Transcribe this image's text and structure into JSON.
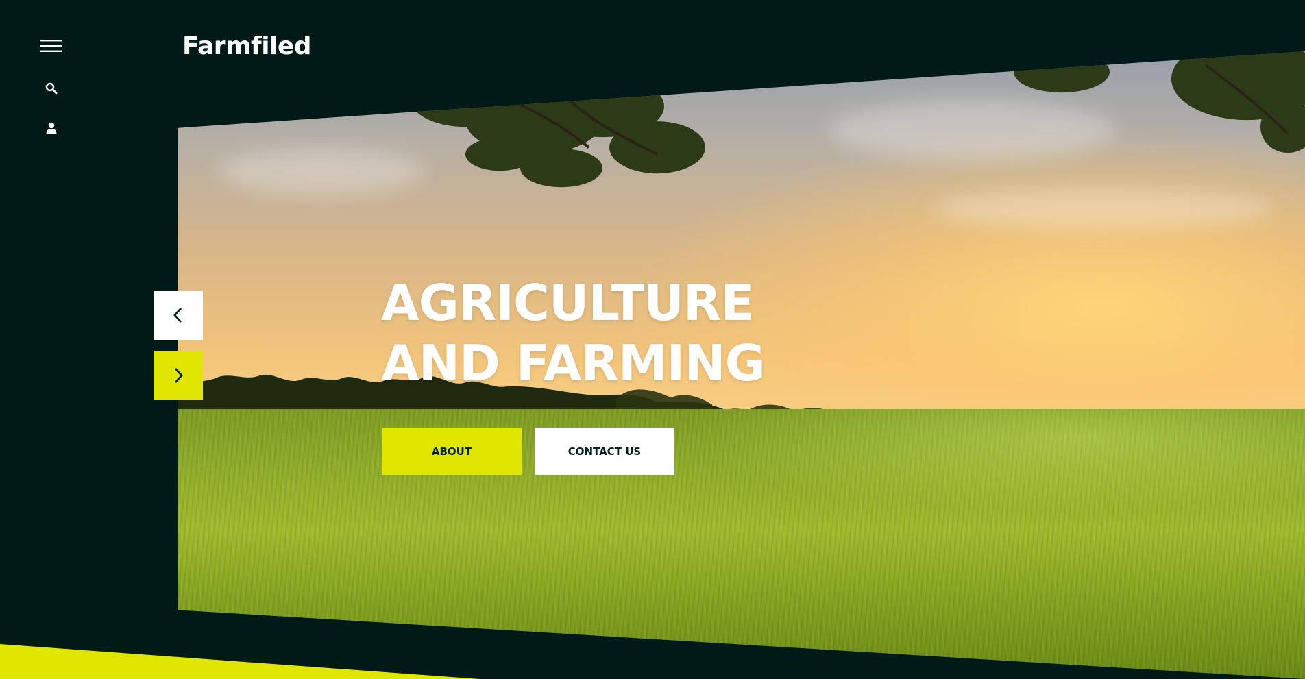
{
  "brand": {
    "logo_text": "Farmfiled"
  },
  "rail": {
    "icons": [
      "menu-icon",
      "search-icon",
      "user-icon"
    ]
  },
  "hero": {
    "headline_line1": "AGRICULTURE",
    "headline_line2": "AND FARMING",
    "buttons": {
      "about_label": "ABOUT",
      "contact_label": "CONTACT US"
    },
    "slider": {
      "prev_icon": "chevron-left-icon",
      "next_icon": "chevron-right-icon"
    }
  },
  "colors": {
    "background": "#001a17",
    "accent": "#e1e600",
    "button_text": "#00211c",
    "white": "#ffffff"
  }
}
